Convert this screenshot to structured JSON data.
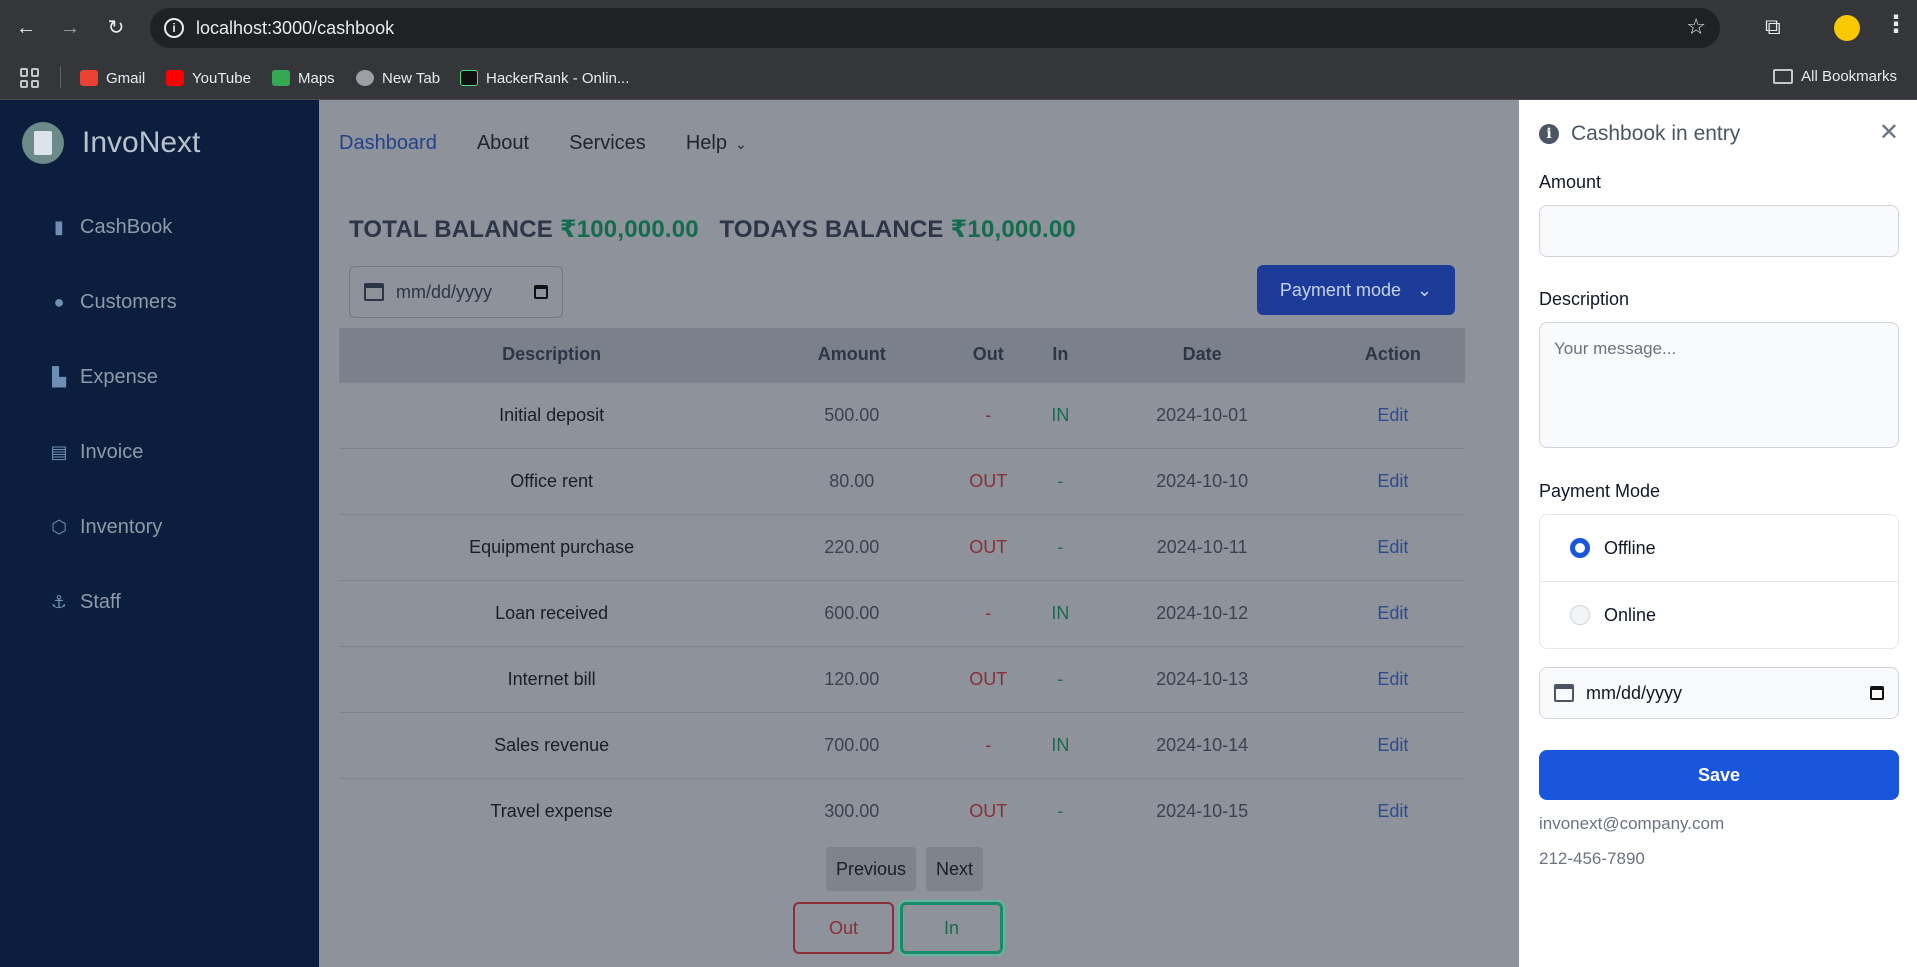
{
  "browser": {
    "url": "localhost:3000/cashbook",
    "bookmarks": [
      {
        "label": "Gmail",
        "color": "#ea4335"
      },
      {
        "label": "YouTube",
        "color": "#ff0000"
      },
      {
        "label": "Maps",
        "color": "#34a853"
      },
      {
        "label": "New Tab",
        "color": "#9aa0a6"
      },
      {
        "label": "HackerRank - Onlin...",
        "color": "#111111"
      }
    ],
    "all_bookmarks": "All Bookmarks"
  },
  "sidebar": {
    "brand": "InvoNext",
    "items": [
      {
        "label": "CashBook",
        "icon": "book-icon"
      },
      {
        "label": "Customers",
        "icon": "user-icon"
      },
      {
        "label": "Expense",
        "icon": "chart-icon"
      },
      {
        "label": "Invoice",
        "icon": "file-icon"
      },
      {
        "label": "Inventory",
        "icon": "box-icon"
      },
      {
        "label": "Staff",
        "icon": "staff-icon"
      }
    ]
  },
  "topnav": {
    "items": [
      "Dashboard",
      "About",
      "Services",
      "Help"
    ]
  },
  "balances": {
    "total_label": "TOTAL BALANCE",
    "total_value": "₹100,000.00",
    "today_label": "TODAYS BALANCE",
    "today_value": "₹10,000.00"
  },
  "filters": {
    "date_placeholder": "mm/dd/yyyy",
    "payment_mode_label": "Payment mode"
  },
  "table": {
    "headers": [
      "Description",
      "Amount",
      "Out",
      "In",
      "Date",
      "Action"
    ],
    "rows": [
      [
        "Initial deposit",
        "500.00",
        "-",
        "IN",
        "2024-10-01",
        "Edit"
      ],
      [
        "Office rent",
        "80.00",
        "OUT",
        "-",
        "2024-10-10",
        "Edit"
      ],
      [
        "Equipment purchase",
        "220.00",
        "OUT",
        "-",
        "2024-10-11",
        "Edit"
      ],
      [
        "Loan received",
        "600.00",
        "-",
        "IN",
        "2024-10-12",
        "Edit"
      ],
      [
        "Internet bill",
        "120.00",
        "OUT",
        "-",
        "2024-10-13",
        "Edit"
      ],
      [
        "Sales revenue",
        "700.00",
        "-",
        "IN",
        "2024-10-14",
        "Edit"
      ],
      [
        "Travel expense",
        "300.00",
        "OUT",
        "-",
        "2024-10-15",
        "Edit"
      ]
    ]
  },
  "pager": {
    "previous": "Previous",
    "next": "Next"
  },
  "actions": {
    "out": "Out",
    "in": "In"
  },
  "drawer": {
    "title": "Cashbook in entry",
    "amount_label": "Amount",
    "amount_value": "",
    "description_label": "Description",
    "description_placeholder": "Your message...",
    "payment_mode_label": "Payment Mode",
    "options": [
      {
        "label": "Offline",
        "selected": true
      },
      {
        "label": "Online",
        "selected": false
      }
    ],
    "date_placeholder": "mm/dd/yyyy",
    "save_label": "Save",
    "email": "invonext@company.com",
    "phone": "212-456-7890"
  },
  "colors": {
    "accent": "#1a56db",
    "sidebar": "#0b1e3d",
    "in_green": "#1c6a4c",
    "out_red": "#8a2e38"
  }
}
